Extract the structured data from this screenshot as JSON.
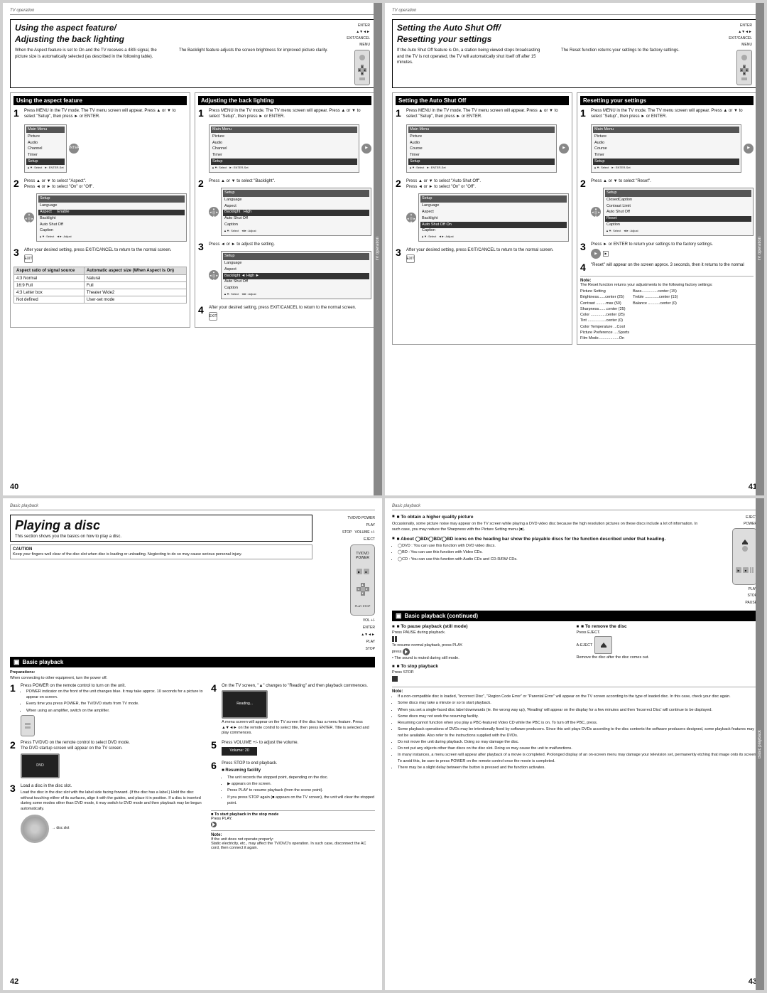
{
  "pages": {
    "top_left": {
      "topbar": "TV operation",
      "title_italic": "Using the aspect feature/",
      "title_bold": "Adjusting the back lighting",
      "intro_left": "When the Aspect feature is set to On and the TV receives a 480i signal, the picture size is automatically selected (as described in the following table).",
      "intro_right": "The Backlight feature adjusts the screen brightness for improved picture clarity.",
      "remote_labels": [
        "ENTER",
        "▲▼◄►",
        "EXIT/CANCEL",
        "MENU"
      ],
      "col1_header": "Using the aspect feature",
      "col2_header": "Adjusting the back lighting",
      "step1_left": "Press MENU in the TV mode. The TV menu screen will appear. Press ▲ or ▼ to select \"Setup\", then press ► or ENTER.",
      "step2_left": "Press ▲ or ▼ to select \"Aspect\".\nPress ◄ or ► to select \"On\" or \"Off\".",
      "step3_left": "After your desired setting, press EXIT/CANCEL to return to the normal screen.",
      "step1_right": "Press MENU in the TV mode. The TV menu screen will appear. Press ▲ or ▼ to select \"Setup\", then press ► or ENTER.",
      "step2_right": "Press ▲ or ▼ to select \"Backlight\".",
      "step3_right": "Press ◄ or ► to adjust the setting.",
      "step4_right": "After your desired setting, press EXIT/CANCEL to return to the normal screen.",
      "table_headers": [
        "Aspect ratio of signal source",
        "Automatic aspect size (When Aspect is On)"
      ],
      "table_rows": [
        [
          "4:3 Normal",
          "Natural"
        ],
        [
          "16:9 Full",
          "Full"
        ],
        [
          "4:3 Letter box",
          "Theater Wide2"
        ],
        [
          "Not defined",
          "User-set mode"
        ]
      ],
      "page_number": "40",
      "menu_items_left": [
        "Picture",
        "Audio",
        "Channel",
        "Timer",
        "Setup"
      ],
      "menu_items_right": [
        "Picture",
        "Audio",
        "Channel",
        "Timer",
        "Setup"
      ],
      "setup_items": [
        "Language",
        "Aspect",
        "Backlight",
        "Auto Shut Off",
        "Caption"
      ],
      "side_label": "TV operation"
    },
    "top_right": {
      "topbar": "TV operation",
      "title_italic": "Setting the Auto Shut Off/",
      "title_bold": "Resetting your settings",
      "intro_left": "If the Auto Shut Off feature is On, a station being viewed stops broadcasting and the TV is not operated, the TV will automatically shut itself off after 15 minutes.",
      "intro_right": "The Reset function returns your settings to the factory settings.",
      "remote_labels": [
        "ENTER",
        "▲▼◄►",
        "EXIT/CANCEL",
        "MENU"
      ],
      "col1_header": "Setting the Auto Shut Off",
      "col2_header": "Resetting your settings",
      "step1_left": "Press MENU in the TV mode. The TV menu screen will appear. Press ▲ or ▼ to select \"Setup\", then press ► or ENTER.",
      "step2_left": "Press ▲ or ▼ to select \"Auto Shut Off\".\nPress ◄ or ► to select \"On\" or \"Off\".",
      "step3_left": "After your desired setting, press EXIT/CANCEL to return to the normal screen.",
      "step1_right": "Press MENU in the TV mode. The TV menu screen will appear. Press ▲ or ▼ to select \"Setup\", then press ► or ENTER.",
      "step2_right": "Press ▲ or ▼ to select \"Reset\".",
      "step3_right": "Press ► or ENTER to return your settings to the factory settings.",
      "step4_right": "\"Reset\" will appear on the screen approx. 3 seconds, then it returns to the normal",
      "note_title": "Note:",
      "note_text": "The Reset function returns your adjustments to the following factory settings:",
      "factory_settings": [
        "Picture Setting",
        "Brightness......center (25)",
        "Contrast .........max (50)",
        "Sharpness.......center (25)",
        "Color ..............center (25)",
        "Tint .................center (0)",
        "Color Temperature ...Cool",
        "Picture Preference ....Sports",
        "Film Mode...................On"
      ],
      "factory_settings_right": [
        "Bass...............center (15)",
        "Treble .............center (15)",
        "Balance ...........center (0)"
      ],
      "page_number": "41",
      "side_label": "TV operation"
    },
    "bottom_left": {
      "topbar": "Basic playback",
      "title_italic": "Playing a disc",
      "intro": "This section shows you the basics on how to play a disc.",
      "caution_title": "CAUTION",
      "caution_text": "Keep your fingers well clear of the disc slot when disc is loading or unloading. Neglecting to do so may cause serious personal injury.",
      "section_header": "Basic playback",
      "preparations_title": "Preparations:",
      "preparations_text": "When connecting to other equipment, turn the power off.",
      "step1": "Press POWER on the remote control to turn on the unit.",
      "step1_bullets": [
        "POWER indicator on the front of the unit changes blue. It may take approx. 10 seconds for a picture to appear on screen.",
        "Every time you press POWER, the TV/DVD starts from TV mode.",
        "When using an amplifier, switch on the amplifier."
      ],
      "step2": "Press TV/DVD on the remote control to select DVD mode.",
      "step2_sub": "The DVD startup screen will appear on the TV screen.",
      "step3": "Load a disc in the disc slot.",
      "step3_sub": "Load the disc in the disc slot with the label side facing forward. (If the disc has a label.) Hold the disc without touching either of its surfaces, align it with the guides, and place it in position.\nIf a disc is inserted during some modes other than DVD mode, it may switch to DVD mode and then playback may be begun automatically.",
      "step4": "On the TV screen, \"▲\" changes to \"Reading\" and then playback commences.",
      "step4_sub": "A menu screen will appear on the TV screen if the disc has a menu feature.\nPress ▲▼◄► on the remote control to select title, then press ENTER. Title is selected and play commences.",
      "step5": "Press VOLUME +/- to adjust the volume.",
      "step6": "Press STOP to end playback.",
      "resuming_title": "■ Resuming facility",
      "resuming_bullets": [
        "The unit records the stopped point, depending on the disc.",
        "▶ appears on the screen.",
        "Press PLAY to resume playback (from the scene point).",
        "If you press STOP again (■ appears on the TV screen), the unit will clear the stopped point."
      ],
      "start_stop_title": "■ To start playback in the stop mode",
      "start_stop_text": "Press PLAY.",
      "note_title": "Note:",
      "note_text": "If the unit does not operate properly:",
      "note_sub": "Static electricity, etc., may affect the TV/DVD's operation. In such case, disconnect the AC cord, then connect it again.",
      "remote_right_labels": [
        "TV/DVD\nPOWER",
        "VOL +/-",
        "ENTER",
        "▲▼◄►",
        "PLAY",
        "STOP"
      ],
      "remote_side_labels": [
        "PLAY",
        "STOP",
        "VOLUME +/-",
        "EJECT",
        "VOL +/-"
      ],
      "page_number": "42"
    },
    "bottom_right": {
      "topbar": "Basic playback",
      "higher_quality_title": "■ To obtain a higher quality picture",
      "higher_quality_text": "Occasionally, some picture noise may appear on the TV screen while playing a DVD video disc because the high resolution pictures on these discs include a lot of information. In such case, you may reduce the Sharpness with the Picture Setting menu (■).",
      "about_title": "■ About ◯BD/◯BD/◯BD icons on the heading bar show the playable discs for the function described under that heading.",
      "about_bullets": [
        "◯DVD : You can use this function with DVD video discs.",
        "◯BD : You can use this function with Video CDs.",
        "◯CD : You can use this function with Audio CDs and CD-R/RW CDs."
      ],
      "section_header": "Basic playback (continued)",
      "pause_title": "■ To pause playback (still mode)",
      "pause_text": "Press PAUSE during playback.",
      "pause_sub1": "To resume normal playback, press PLAY.",
      "pause_sub2": "• The sound is muted during still mode.",
      "remove_title": "■ To remove the disc",
      "remove_text": "Press EJECT.",
      "remove_sub": "Remove the disc after the disc comes out.",
      "stop_title": "■ To stop playback",
      "stop_text": "Press STOP.",
      "note_title": "Note:",
      "note_bullets": [
        "If a non-compatible disc is loaded, \"Incorrect Disc\", \"Region Code Error\" or \"Parental Error\" will appear on the TV screen according to the type of loaded disc. In this case, check your disc again.",
        "Some discs may take a minute or so to start playback.",
        "When you set a single-faced disc label downwards (ie. the wrong way up), 'Reading' will appear on the display for a few minutes and then 'Incorrect Disc' will continue to be displayed.",
        "Some discs may not work the resuming facility.",
        "Resuming cannot function when you play a PBC-featured Video CD while the PBC is on. To turn off the PBC, press.",
        "Some playback operations of DVDs may be intentionally fixed by software producers. Since this unit plays DVDs according to the disc contents the software producers designed, some playback features may not be available. Also refer to the instructions supplied with the DVDs.",
        "Do not move the unit during playback. Doing so may damage the disc.",
        "Do not put any objects other than discs on the disc slot. Doing so may cause the unit to malfunctions.",
        "In many instances, a menu screen will appear after playback of a movie is completed. Prolonged display of an on-screen menu may damage your television set, permanently etching that image onto its screen. To avoid this, be sure to press POWER on the remote control once the movie is completed.",
        "There may be a slight delay between the button is pressed and the function activates."
      ],
      "right_labels": [
        "EJECT",
        "POWER",
        "PLAY",
        "STOP",
        "PAUSE"
      ],
      "page_number": "43",
      "side_label": "Basic playback"
    }
  }
}
